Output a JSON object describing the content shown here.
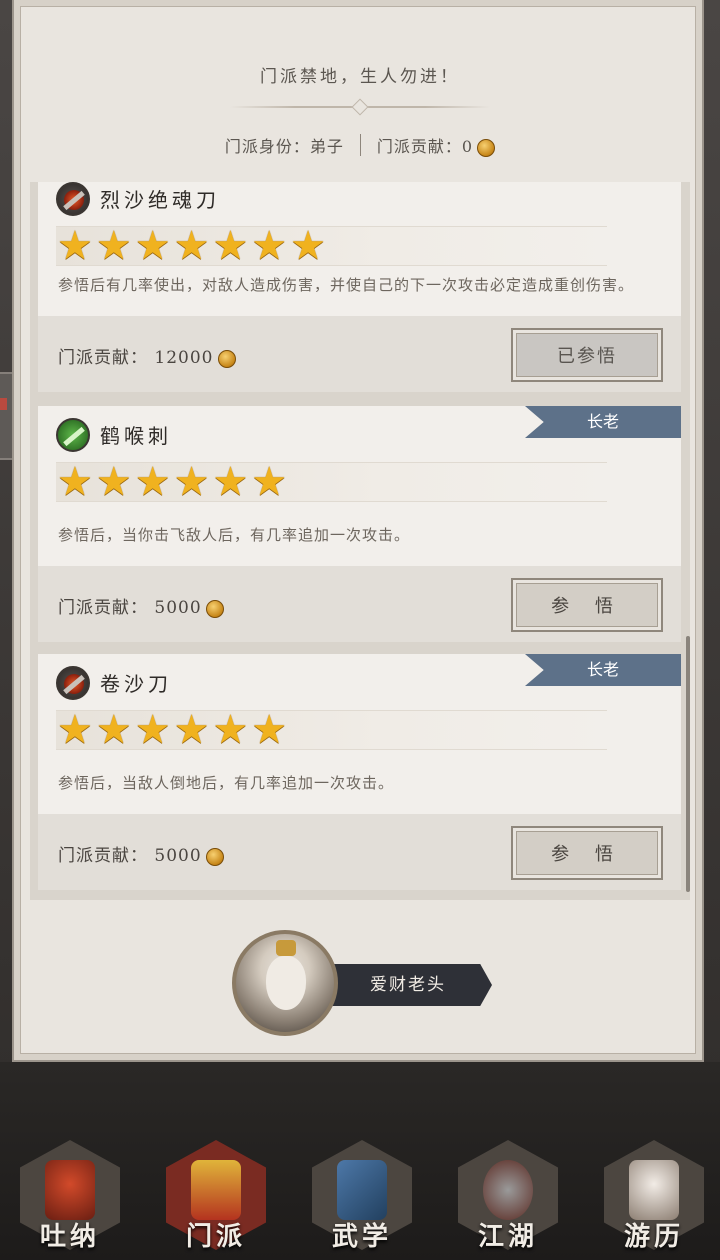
{
  "header": {
    "banner": "门派禁地，生人勿进！",
    "identity_label": "门派身份：弟子",
    "contribution_label": "门派贡献：",
    "contribution_value": "0"
  },
  "skills": [
    {
      "name": "烈沙绝魂刀",
      "stars": 7,
      "description": "参悟后有几率使出，对敌人造成伤害，并使自己的下一次攻击必定造成重创伤害。",
      "cost_label": "门派贡献：",
      "cost": "12000",
      "button": "已参悟",
      "icon": "saber-fire-icon"
    },
    {
      "name": "鹤喉刺",
      "rank": "长老",
      "stars": 6,
      "description": "参悟后，当你击飞敌人后，有几率追加一次攻击。",
      "cost_label": "门派贡献：",
      "cost": "5000",
      "button": "参 悟",
      "icon": "green-dagger-icon"
    },
    {
      "name": "卷沙刀",
      "rank": "长老",
      "stars": 6,
      "description": "参悟后，当敌人倒地后，有几率追加一次攻击。",
      "cost_label": "门派贡献：",
      "cost": "5000",
      "button": "参 悟",
      "icon": "saber-fire-icon"
    }
  ],
  "npc": {
    "name": "爱财老头"
  },
  "nav": {
    "items": [
      {
        "label": "吐纳"
      },
      {
        "label": "门派"
      },
      {
        "label": "武学"
      },
      {
        "label": "江湖"
      },
      {
        "label": "游历"
      }
    ]
  },
  "colors": {
    "rank_tag": "#5d7189",
    "star": "#f0b21f",
    "active_nav": "#7a2b22"
  }
}
